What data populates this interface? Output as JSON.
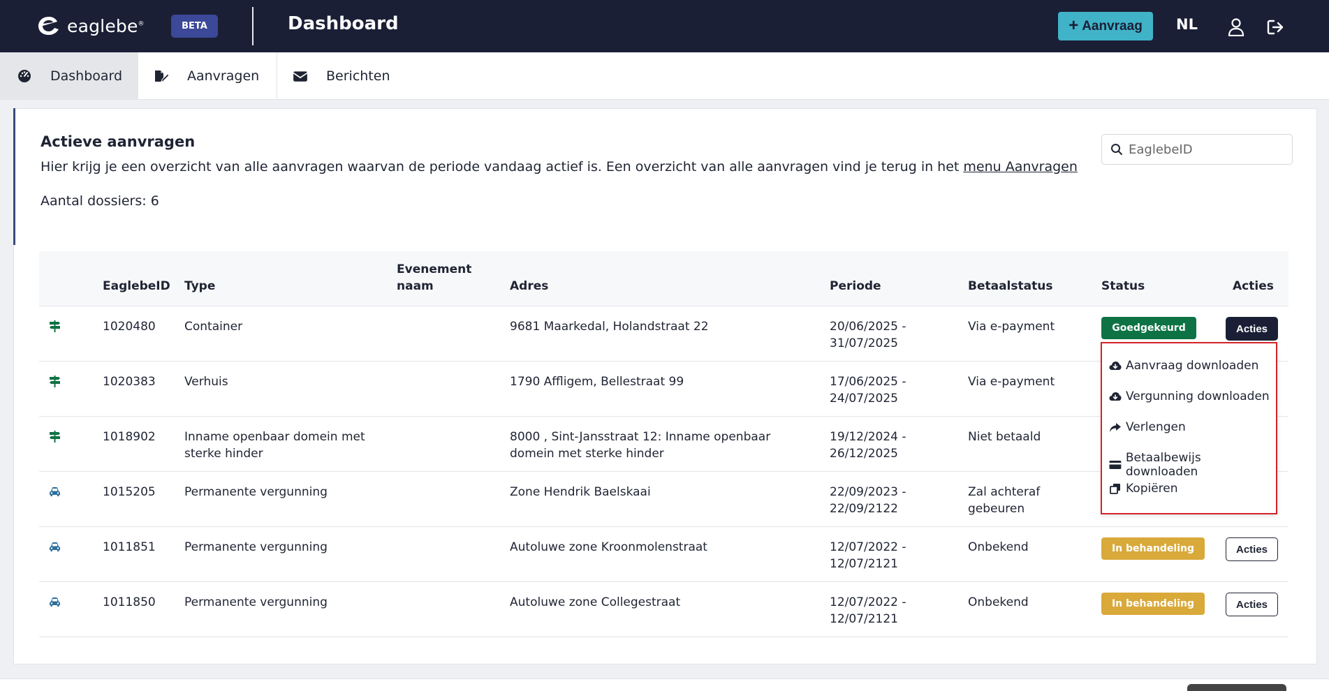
{
  "header": {
    "logo_text": "eaglebe",
    "logo_reg": "®",
    "beta_label": "BETA",
    "page_title": "Dashboard",
    "new_request_label": "Aanvraag",
    "language": "NL"
  },
  "tabs": [
    {
      "label": "Dashboard",
      "icon": "dashboard-icon",
      "active": true
    },
    {
      "label": "Aanvragen",
      "icon": "edit-document-icon",
      "active": false
    },
    {
      "label": "Berichten",
      "icon": "envelope-icon",
      "active": false
    }
  ],
  "card": {
    "title": "Actieve aanvragen",
    "description": "Hier krijg je een overzicht van alle aanvragen waarvan de periode vandaag actief is. Een overzicht van alle aanvragen vind je terug in het ",
    "description_link": "menu Aanvragen",
    "count": "Aantal dossiers: 6",
    "search_placeholder": "EaglebeID"
  },
  "table": {
    "headers": {
      "id": "EaglebeID",
      "type": "Type",
      "event_line1": "Evenement",
      "event_line2": "naam",
      "address": "Adres",
      "period": "Periode",
      "payment": "Betaalstatus",
      "status": "Status",
      "actions": "Acties"
    },
    "rows": [
      {
        "icon": "signpost-icon",
        "id": "1020480",
        "type_l1": "Container",
        "type_l2": "",
        "address_l1": "9681 Maarkedal, Holandstraat 22",
        "address_l2": "",
        "period_l1": "20/06/2025 -",
        "period_l2": "31/07/2025",
        "payment_l1": "Via e-payment",
        "payment_l2": "",
        "status": "Goedgekeurd",
        "status_color": "#0e7344",
        "action": "Acties"
      },
      {
        "icon": "signpost-icon",
        "id": "1020383",
        "type_l1": "Verhuis",
        "type_l2": "",
        "address_l1": "1790 Affligem, Bellestraat 99",
        "address_l2": "",
        "period_l1": "17/06/2025 -",
        "period_l2": "24/07/2025",
        "payment_l1": "Via e-payment",
        "payment_l2": "",
        "status": "",
        "status_color": "",
        "action": ""
      },
      {
        "icon": "signpost-icon",
        "id": "1018902",
        "type_l1": "Inname openbaar domein met",
        "type_l2": "sterke hinder",
        "address_l1": "8000 , Sint-Jansstraat 12: Inname openbaar",
        "address_l2": "domein met sterke hinder",
        "period_l1": "19/12/2024 -",
        "period_l2": "26/12/2025",
        "payment_l1": "Niet betaald",
        "payment_l2": "",
        "status": "",
        "status_color": "",
        "action": ""
      },
      {
        "icon": "car-icon",
        "id": "1015205",
        "type_l1": "Permanente vergunning",
        "type_l2": "",
        "address_l1": "Zone Hendrik Baelskaai",
        "address_l2": "",
        "period_l1": "22/09/2023 -",
        "period_l2": "22/09/2122",
        "payment_l1": "Zal achteraf",
        "payment_l2": "gebeuren",
        "status": "",
        "status_color": "",
        "action": ""
      },
      {
        "icon": "car-icon",
        "id": "1011851",
        "type_l1": "Permanente vergunning",
        "type_l2": "",
        "address_l1": "Autoluwe zone Kroonmolenstraat",
        "address_l2": "",
        "period_l1": "12/07/2022 -",
        "period_l2": "12/07/2121",
        "payment_l1": "Onbekend",
        "payment_l2": "",
        "status": "In behandeling",
        "status_color": "#d9a93a",
        "action": "Acties"
      },
      {
        "icon": "car-icon",
        "id": "1011850",
        "type_l1": "Permanente vergunning",
        "type_l2": "",
        "address_l1": "Autoluwe zone Collegestraat",
        "address_l2": "",
        "period_l1": "12/07/2022 -",
        "period_l2": "12/07/2121",
        "payment_l1": "Onbekend",
        "payment_l2": "",
        "status": "In behandeling",
        "status_color": "#d9a93a",
        "action": "Acties"
      }
    ]
  },
  "dropdown": {
    "items": [
      {
        "label": "Aanvraag downloaden",
        "icon": "cloud-download-icon"
      },
      {
        "label": "Vergunning downloaden",
        "icon": "cloud-download-icon"
      },
      {
        "label": "Verlengen",
        "icon": "share-arrow-icon"
      },
      {
        "label": "Betaalbewijs downloaden",
        "icon": "credit-card-icon"
      },
      {
        "label": "Kopiëren",
        "icon": "copy-icon"
      }
    ]
  },
  "colors": {
    "topbar": "#1a1f36",
    "accent": "#40b3c8",
    "approved": "#0e7344",
    "pending": "#d9a93a",
    "highlight_border": "#d5232a"
  }
}
